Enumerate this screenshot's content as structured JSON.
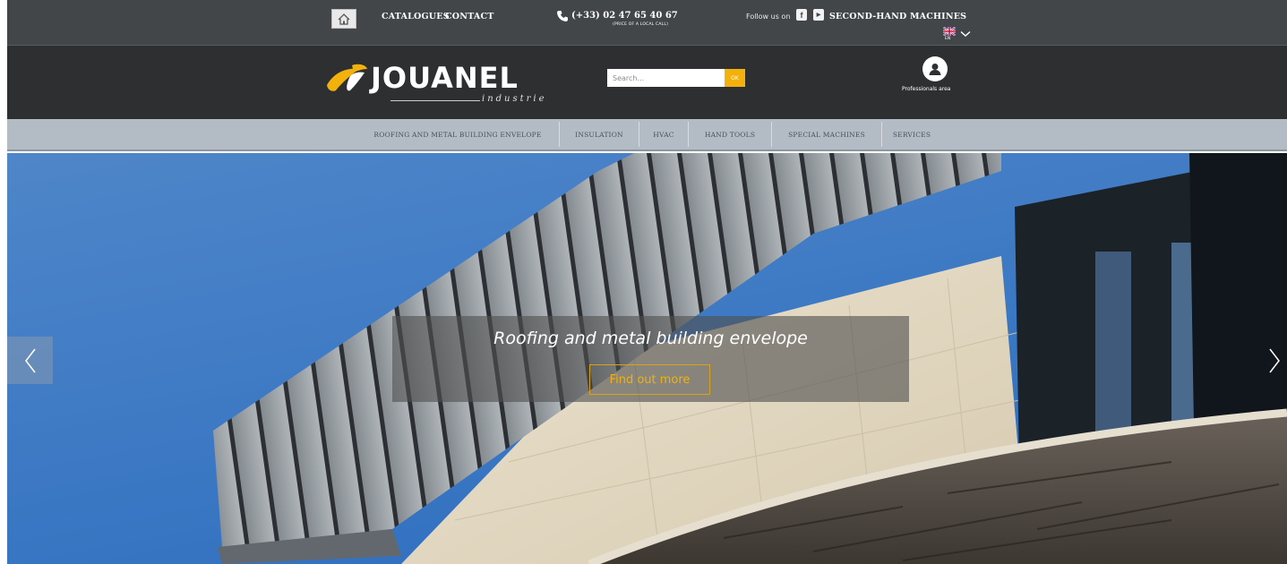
{
  "topbar": {
    "home_icon": "home-icon",
    "catalogues": "CATALOGUES",
    "contact": "CONTACT",
    "phone_icon": "phone-icon",
    "phone": "(+33) 02 47 65 40 67",
    "phone_note": "(PRICE OF A LOCAL CALL)",
    "follow": "Follow us on",
    "social": [
      {
        "icon": "facebook-icon",
        "glyph": "f"
      },
      {
        "icon": "youtube-icon",
        "glyph": "▶"
      }
    ],
    "second_hand": "SECOND-HAND MACHINES",
    "language": "EN",
    "flag_icon": "uk-flag-icon"
  },
  "brand": {
    "name": "JOUANEL",
    "subtitle": "industrie",
    "search_placeholder": "Search...",
    "search_button": "OK",
    "account_icon": "user-icon",
    "account_label": "Professionals area"
  },
  "nav": {
    "items": [
      "ROOFING AND METAL BUILDING ENVELOPE",
      "INSULATION",
      "HVAC",
      "HAND TOOLS",
      "SPECIAL MACHINES",
      "SERVICES"
    ]
  },
  "hero": {
    "title": "Roofing and metal building envelope",
    "cta": "Find out more",
    "prev_icon": "chevron-left-icon",
    "next_icon": "chevron-right-icon"
  },
  "colors": {
    "accent": "#f2b10d",
    "topbar": "#434649",
    "brandbar": "#2d2f31",
    "navbar": "#b3bcc4"
  }
}
